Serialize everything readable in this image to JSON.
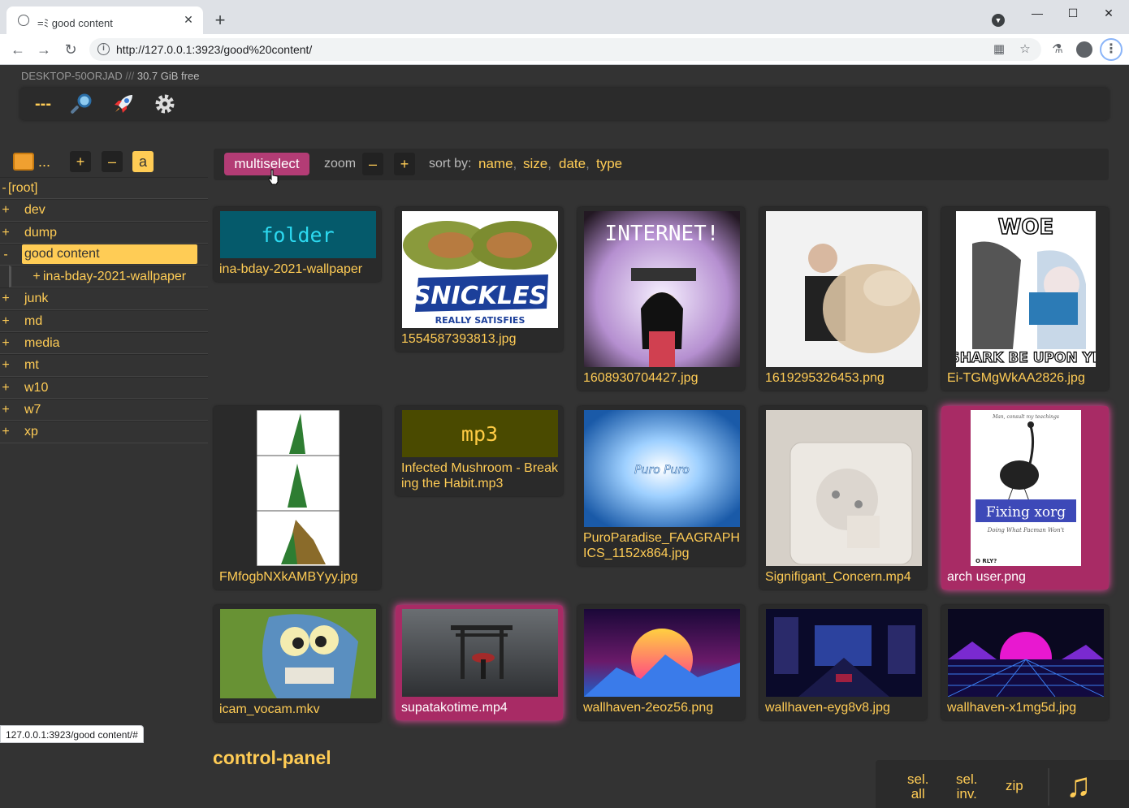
{
  "browser": {
    "tab_title": "good content",
    "tab_glyph": "=ﾐ",
    "url": "http://127.0.0.1:3923/good%20content/",
    "status_text": "127.0.0.1:3923/good content/#"
  },
  "header": {
    "hostname": "DESKTOP-50ORJAD",
    "separator": "///",
    "free_space": "30.7 GiB free",
    "ops_dash": "---"
  },
  "treetools": {
    "dots": "...",
    "plus": "+",
    "minus": "–",
    "a": "a"
  },
  "tree": [
    {
      "pm": "-",
      "name": "[root]",
      "indent": 0
    },
    {
      "pm": "+",
      "name": "dev",
      "indent": 0
    },
    {
      "pm": "+",
      "name": "dump",
      "indent": 0
    },
    {
      "pm": "-",
      "name": "good content",
      "indent": 0,
      "selected": true
    },
    {
      "pm": "+",
      "name": "ina-bday-2021-wallpaper",
      "indent": 1
    },
    {
      "pm": "+",
      "name": "junk",
      "indent": 0
    },
    {
      "pm": "+",
      "name": "md",
      "indent": 0
    },
    {
      "pm": "+",
      "name": "media",
      "indent": 0
    },
    {
      "pm": "+",
      "name": "mt",
      "indent": 0
    },
    {
      "pm": "+",
      "name": "w10",
      "indent": 0
    },
    {
      "pm": "+",
      "name": "w7",
      "indent": 0
    },
    {
      "pm": "+",
      "name": "xp",
      "indent": 0
    }
  ],
  "filebar": {
    "multiselect": "multiselect",
    "zoom": "zoom",
    "zoom_out": "–",
    "zoom_in": "+",
    "sort_by": "sort by:",
    "sort_keys": [
      "name",
      "size",
      "date",
      "type"
    ],
    "comma": ","
  },
  "files": [
    {
      "name": "ina-bday-2021-wallpaper",
      "kind": "folder",
      "label": "folder"
    },
    {
      "name": "1554587393813.jpg",
      "kind": "image",
      "art": "snickles"
    },
    {
      "name": "1608930704427.jpg",
      "kind": "image",
      "art": "internet",
      "text": "INTERNET!"
    },
    {
      "name": "1619295326453.png",
      "kind": "image",
      "art": "blur"
    },
    {
      "name": "Ei-TGMgWkAA2826.jpg",
      "kind": "image",
      "art": "woe",
      "text_top": "WOE",
      "text_bottom": "SHARK BE UPON YE"
    },
    {
      "name": "FMfogbNXkAMBYyy.jpg",
      "kind": "image",
      "art": "comic"
    },
    {
      "name": "Infected Mushroom - Breaking the Habit.mp3",
      "kind": "audio",
      "label": "mp3"
    },
    {
      "name": "PuroParadise_FAAGRAPHICS_1152x864.jpg",
      "kind": "image",
      "art": "puro",
      "text": "Puro Puro"
    },
    {
      "name": "Signifigant_Concern.mp4",
      "kind": "video",
      "art": "socket"
    },
    {
      "name": "arch user.png",
      "kind": "image",
      "art": "orly",
      "highlight": true,
      "text": "Fixing xorg",
      "subtitle": "Doing What Pacman Won't",
      "brand": "O RLY?"
    },
    {
      "name": "icam_vocam.mkv",
      "kind": "video",
      "art": "skull"
    },
    {
      "name": "supatakotime.mp4",
      "kind": "video",
      "art": "torii",
      "highlight": true
    },
    {
      "name": "wallhaven-2eoz56.png",
      "kind": "image",
      "art": "sunset1"
    },
    {
      "name": "wallhaven-eyg8v8.jpg",
      "kind": "image",
      "art": "city"
    },
    {
      "name": "wallhaven-x1mg5d.jpg",
      "kind": "image",
      "art": "sunset2"
    }
  ],
  "control_panel": "control-panel",
  "zip_bar": {
    "sel_all": [
      "sel.",
      "all"
    ],
    "sel_inv": [
      "sel.",
      "inv."
    ],
    "zip": "zip"
  },
  "colors": {
    "accent": "#ffcc55",
    "highlight": "#a82b65",
    "bg": "#333333"
  }
}
